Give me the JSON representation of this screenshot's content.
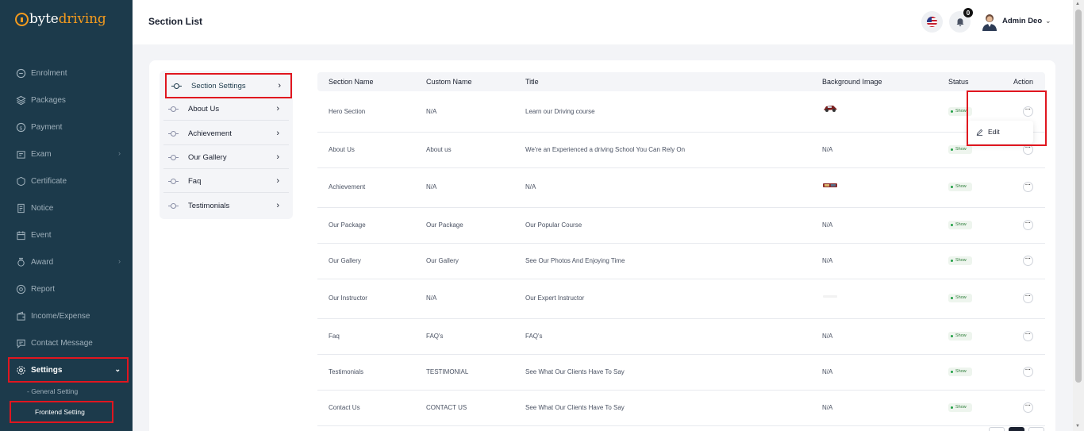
{
  "brand": {
    "part1": "byte",
    "part2": "driving",
    "accent_color": "#f39a1e",
    "sidebar_color": "#1c3a4b"
  },
  "sidebar": {
    "items": [
      {
        "label": "Enrolment",
        "icon": "enrolment-icon"
      },
      {
        "label": "Packages",
        "icon": "packages-icon"
      },
      {
        "label": "Payment",
        "icon": "payment-icon"
      },
      {
        "label": "Exam",
        "icon": "exam-icon",
        "has_children": true
      },
      {
        "label": "Certificate",
        "icon": "certificate-icon"
      },
      {
        "label": "Notice",
        "icon": "notice-icon"
      },
      {
        "label": "Event",
        "icon": "event-icon"
      },
      {
        "label": "Award",
        "icon": "award-icon",
        "has_children": true
      },
      {
        "label": "Report",
        "icon": "report-icon"
      },
      {
        "label": "Income/Expense",
        "icon": "wallet-icon"
      },
      {
        "label": "Contact Message",
        "icon": "message-icon"
      },
      {
        "label": "Settings",
        "icon": "gear-icon",
        "expanded": true
      }
    ],
    "sub_items": [
      {
        "label": "- General Setting"
      },
      {
        "label": "Frontend Setting"
      }
    ]
  },
  "header": {
    "title": "Section List",
    "notification_count": "0",
    "user_name": "Admin Deo"
  },
  "section_menu": [
    {
      "label": "Section Settings"
    },
    {
      "label": "About Us"
    },
    {
      "label": "Achievement"
    },
    {
      "label": "Our Gallery"
    },
    {
      "label": "Faq"
    },
    {
      "label": "Testimonials"
    }
  ],
  "table": {
    "columns": [
      "Section Name",
      "Custom Name",
      "Title",
      "Background Image",
      "Status",
      "Action"
    ],
    "rows": [
      {
        "section": "Hero Section",
        "custom": "N/A",
        "title": "Learn our Driving course",
        "bg": "",
        "status": "Show"
      },
      {
        "section": "About Us",
        "custom": "About us",
        "title": "We're an Experienced a driving School You Can Rely On",
        "bg": "N/A",
        "status": "Show"
      },
      {
        "section": "Achievement",
        "custom": "N/A",
        "title": "N/A",
        "bg": "",
        "status": "Show"
      },
      {
        "section": "Our Package",
        "custom": "Our Package",
        "title": "Our Popular Course",
        "bg": "N/A",
        "status": "Show"
      },
      {
        "section": "Our Gallery",
        "custom": "Our Gallery",
        "title": "See Our Photos And Enjoying Time",
        "bg": "N/A",
        "status": "Show"
      },
      {
        "section": "Our Instructor",
        "custom": "N/A",
        "title": "Our Expert Instructor",
        "bg": "",
        "status": "Show"
      },
      {
        "section": "Faq",
        "custom": "FAQ's",
        "title": "FAQ's",
        "bg": "N/A",
        "status": "Show"
      },
      {
        "section": "Testimonials",
        "custom": "TESTIMONIAL",
        "title": "See What Our Clients Have To Say",
        "bg": "N/A",
        "status": "Show"
      },
      {
        "section": "Contact Us",
        "custom": "CONTACT US",
        "title": "See What Our Clients Have To Say",
        "bg": "N/A",
        "status": "Show"
      }
    ]
  },
  "action_menu": {
    "edit_label": "Edit"
  },
  "colors": {
    "highlight": "#e0161f",
    "status_green": "#24a148"
  }
}
